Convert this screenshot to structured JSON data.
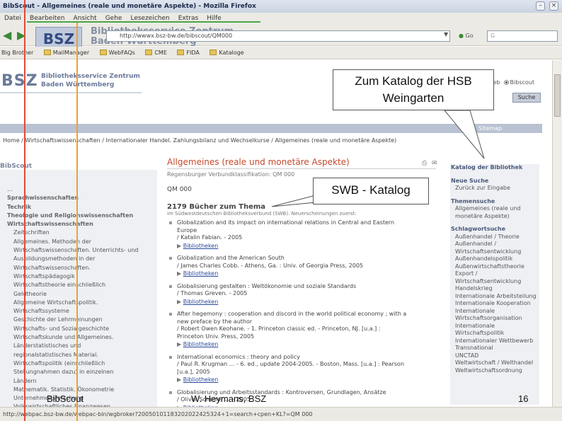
{
  "window": {
    "title": "BibScout - Allgemeines (reale und monetäre Aspekte) - Mozilla Firefox"
  },
  "menu": [
    "Datei",
    "Bearbeiten",
    "Ansicht",
    "Gehe",
    "Lesezeichen",
    "Extras",
    "Hilfe"
  ],
  "nav": {
    "url": "http://wwwx.bsz-bw.de/bibscout/QM000",
    "go_label": "Go",
    "search_value": "G"
  },
  "bookmarks": [
    "Big Brother",
    "MailManager",
    "WebFAQs",
    "CME",
    "FIDA",
    "Kataloge"
  ],
  "header": {
    "logo": "BSZ",
    "logo_title_line1": "Bibliotheksservice Zentrum",
    "logo_title_line2": "Baden-Württemberg",
    "site_logo": "BSZ",
    "site_name_line1": "Bibliotheksservice Zentrum",
    "site_name_line2": "Baden Württemberg",
    "radio_web": "Web",
    "radio_bibscout": "Bibscout",
    "search_button": "Suche",
    "sitemap": "Sitemap"
  },
  "breadcrumb": "Home / Wirtschaftswissenschaften / Internationaler Handel. Zahlungsbilanz und Wechselkurse / Allgemeines (reale und monetäre Aspekte)",
  "sidebar": {
    "heading": "BibScout",
    "items": [
      {
        "label": "...",
        "level": 0,
        "bold": false
      },
      {
        "label": "Sprachwissenschaften",
        "level": 0,
        "bold": true
      },
      {
        "label": "Technik",
        "level": 0,
        "bold": true
      },
      {
        "label": "Theologie und Religionswissenschaften",
        "level": 0,
        "bold": true
      },
      {
        "label": "Wirtschaftswissenschaften",
        "level": 0,
        "bold": true
      },
      {
        "label": "Zeitschriften",
        "level": 1,
        "bold": false
      },
      {
        "label": "Allgemeines. Methoden der",
        "level": 1,
        "bold": false
      },
      {
        "label": "Wirtschaftswissenschaften. Unterrichts- und",
        "level": 1,
        "bold": false
      },
      {
        "label": "Ausbildungsmethoden in der",
        "level": 1,
        "bold": false
      },
      {
        "label": "Wirtschaftswissenschaften.",
        "level": 1,
        "bold": false
      },
      {
        "label": "Wirtschaftspädagogik",
        "level": 1,
        "bold": false
      },
      {
        "label": "Wirtschaftstheorie einschließlich",
        "level": 1,
        "bold": false
      },
      {
        "label": "Geldtheorie",
        "level": 1,
        "bold": false
      },
      {
        "label": "Allgemeine Wirtschaftspolitik.",
        "level": 1,
        "bold": false
      },
      {
        "label": "Wirtschaftssysteme",
        "level": 1,
        "bold": false
      },
      {
        "label": "Geschichte der Lehrmeinungen",
        "level": 1,
        "bold": false
      },
      {
        "label": "Wirtschafts- und Sozialgeschichte",
        "level": 1,
        "bold": false
      },
      {
        "label": "Wirtschaftskunde und Allgemeines.",
        "level": 1,
        "bold": false
      },
      {
        "label": "Länderstatistisches und",
        "level": 1,
        "bold": false
      },
      {
        "label": "regionalstatistisches Material.",
        "level": 1,
        "bold": false
      },
      {
        "label": "Wirtschaftspolitik (einschließlich",
        "level": 1,
        "bold": false
      },
      {
        "label": "Stellungnahmen dazu) in einzelnen",
        "level": 1,
        "bold": false
      },
      {
        "label": "Ländern",
        "level": 1,
        "bold": false
      },
      {
        "label": "Mathematik. Statistik. Ökonometrie",
        "level": 1,
        "bold": false
      },
      {
        "label": "Unternehmensforschung",
        "level": 1,
        "bold": false
      },
      {
        "label": "Volkswirtschaftliches Finanzwesen",
        "level": 1,
        "bold": false
      }
    ]
  },
  "main": {
    "title": "Allgemeines (reale und monetäre Aspekte)",
    "subtitle": "Regensburger Verbundklassifikation: QM 000",
    "code": "QM 000",
    "count_heading": "2179 Bücher zum Thema",
    "count_sub": "im Südwestdeutschen Bibliotheksverbund (SWB). Neuerscheinungen zuerst:",
    "results": [
      {
        "lines": [
          "Globalization and its impact on international relations in Central and Eastern",
          "Europe",
          "/ Katalin Fabian. - 2005"
        ],
        "link": "Bibliotheken"
      },
      {
        "lines": [
          "Globalization and the American South",
          "/ James Charles Cobb. - Athens, Ga. : Univ. of Georgia Press, 2005"
        ],
        "link": "Bibliotheken"
      },
      {
        "lines": [
          "Globalisierung gestalten : Weltökonomie und soziale Standards",
          "/ Thomas Greven. - 2005"
        ],
        "link": "Bibliotheken"
      },
      {
        "lines": [
          "After hegemony : cooperation and discord in the world political economy ; with a",
          "new preface by the author",
          "/ Robert Owen Keohane. - 1. Princeton classic ed. - Princeton, NJ. [u.a.] :",
          "Princeton Univ. Press, 2005"
        ],
        "link": "Bibliotheken"
      },
      {
        "lines": [
          "International economics : theory and policy",
          "/ Paul R. Krugman ... - 6. ed., update 2004-2005. - Boston, Mass. [u.a.] : Pearson",
          "[u.a.], 2005"
        ],
        "link": "Bibliotheken"
      },
      {
        "lines": [
          "Globalisierung und Arbeitsstandards : Kontroversen, Grundlagen, Ansätze",
          "/ Oliver Scherrer ... - 2005"
        ],
        "link": "Bibliotheken"
      }
    ]
  },
  "right": {
    "heading": "Katalog der Bibliothek",
    "sections": [
      {
        "title": "Neue Suche",
        "items": [
          "Zurück zur Eingabe"
        ]
      },
      {
        "title": "Themensuche",
        "items": [
          "Allgemeines (reale und monetäre Aspekte)"
        ]
      },
      {
        "title": "Schlagwortsuche",
        "items": [
          "Außenhandel / Theorie",
          "Außenhandel / Wirtschaftsentwicklung",
          "Außenhandelspolitik",
          "Außenwirtschaftstheorie",
          "Export / Wirtschaftsentwicklung",
          "Handelskrieg",
          "Internationale Arbeitsteilung",
          "Internationale Kooperation",
          "Internationale Wirtschaftsorganisation",
          "Internationale Wirtschaftspolitik",
          "Internationaler Wettbewerb",
          "Transnational",
          "UNCTAD",
          "Weltwirtschaft / Welthandel",
          "Weltwirtschaftsordnung"
        ]
      }
    ]
  },
  "statusbar": "http://webpac.bsz-bw.de/webpac-bin/wgbroker?20050101183202022425324+1=search+cpen+KL?=QM 000",
  "callouts": {
    "katalog": "Zum Katalog der HSB Weingarten",
    "swb": "SWB - Katalog"
  },
  "footer": {
    "left": "BibScout",
    "center": "W. Heymans, BSZ",
    "page": "16"
  }
}
